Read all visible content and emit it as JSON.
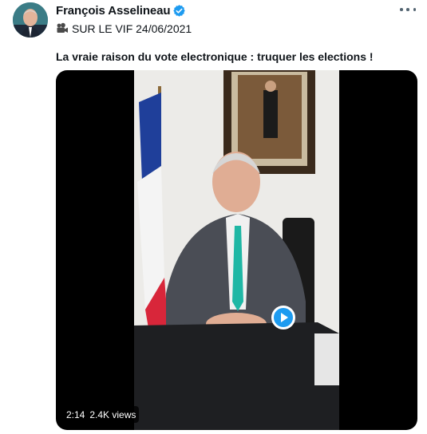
{
  "author": {
    "name": "François Asselineau",
    "verified": true,
    "avatar_icon": "avatar-portrait"
  },
  "post": {
    "subline_icon": "movie-camera-icon",
    "subline": "SUR LE VIF 24/06/2021",
    "text": "La vraie raison du vote electronique : truquer les elections !"
  },
  "video": {
    "duration": "2:14",
    "views": "2.4K views"
  },
  "colors": {
    "accent": "#1d9bf0",
    "text": "#0f1419",
    "muted": "#536471"
  }
}
